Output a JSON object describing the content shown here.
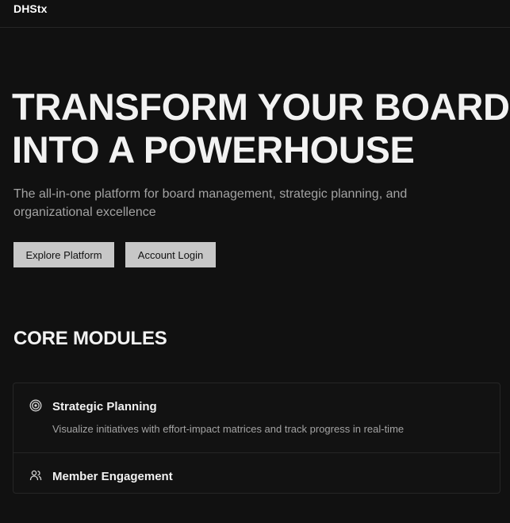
{
  "header": {
    "brand": "DHStx"
  },
  "hero": {
    "title_line1": "TRANSFORM YOUR BOARD",
    "title_line2": "INTO A POWERHOUSE",
    "subtitle": "The all-in-one platform for board management, strategic planning, and organizational excellence"
  },
  "actions": {
    "explore_label": "Explore Platform",
    "login_label": "Account Login"
  },
  "modules": {
    "heading": "CORE MODULES",
    "items": [
      {
        "icon": "target-icon",
        "title": "Strategic Planning",
        "description": "Visualize initiatives with effort-impact matrices and track progress in real-time"
      },
      {
        "icon": "users-icon",
        "title": "Member Engagement",
        "description": ""
      }
    ]
  },
  "colors": {
    "background": "#111111",
    "border": "#262626",
    "button": "#c7c7c7",
    "muted_text": "#a3a3a3"
  }
}
